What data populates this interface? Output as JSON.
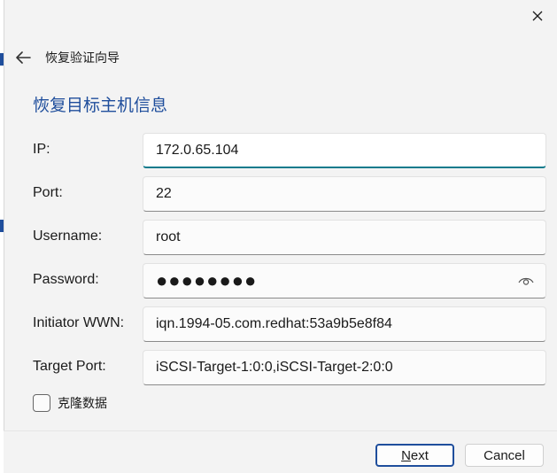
{
  "header": {
    "title": "恢复验证向导"
  },
  "section_title": "恢复目标主机信息",
  "form": {
    "ip": {
      "label": "IP:",
      "value": "172.0.65.104"
    },
    "port": {
      "label": "Port:",
      "value": "22"
    },
    "username": {
      "label": "Username:",
      "value": "root"
    },
    "password": {
      "label": "Password:",
      "value": "●●●●●●●●"
    },
    "initiator_wwn": {
      "label": "Initiator WWN:",
      "value": "iqn.1994-05.com.redhat:53a9b5e8f84"
    },
    "target_port": {
      "label": "Target Port:",
      "value": "iSCSI-Target-1:0:0,iSCSI-Target-2:0:0"
    }
  },
  "clone": {
    "label": "克隆数据",
    "checked": false
  },
  "footer": {
    "next_label_mnemonic": "N",
    "next_label_rest": "ext",
    "cancel_label": "Cancel"
  },
  "icons": {
    "close": "close-icon",
    "back": "back-arrow-icon",
    "reveal": "eye-icon"
  },
  "colors": {
    "accent": "#1f4e9c",
    "focus_underline": "#0f7b8c"
  }
}
